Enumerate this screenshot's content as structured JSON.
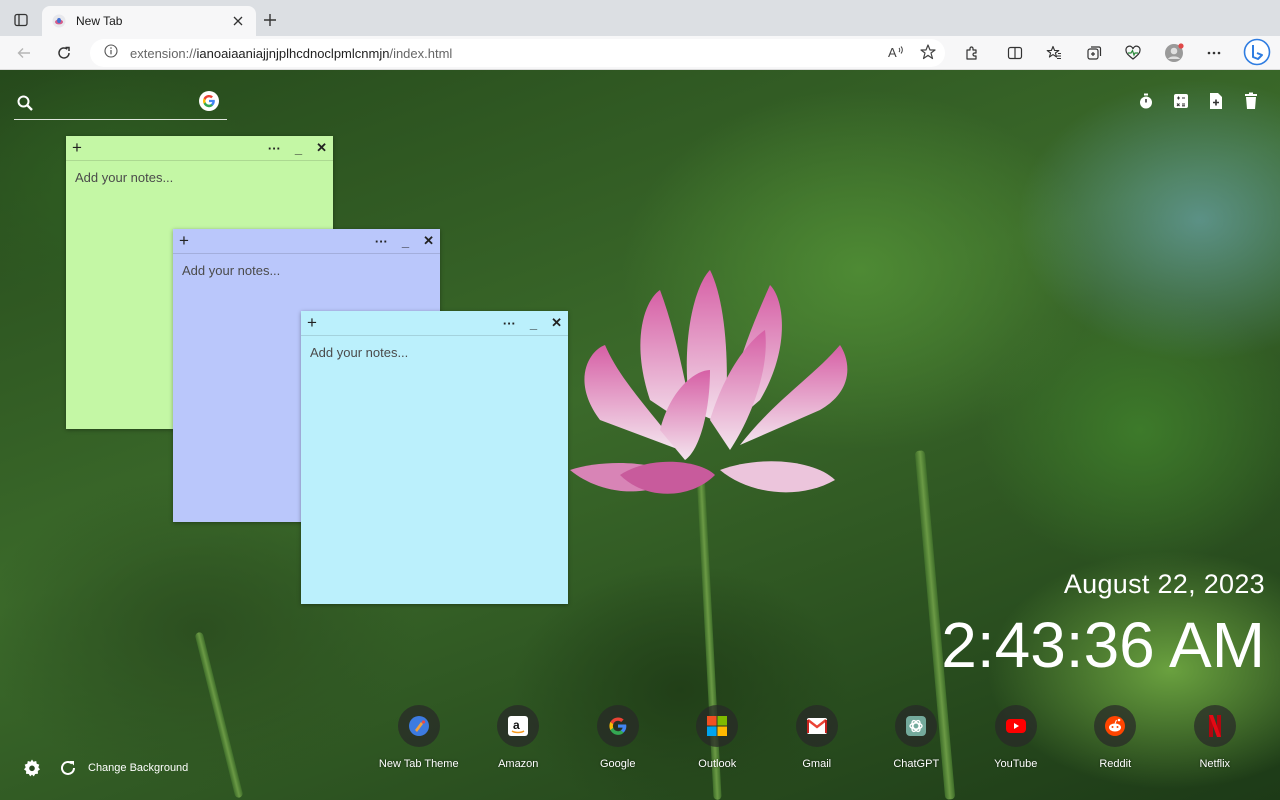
{
  "browser": {
    "tab_title": "New Tab",
    "url_prefix": "extension://",
    "url_host": "ianoaiaaniajjnjplhcdnoclpmlcnmjn",
    "url_path": "/index.html"
  },
  "icons": {
    "tab_actions": "tab-actions-icon",
    "favicon": "lotus-favicon-icon",
    "read_aloud": "read-aloud-icon",
    "favorite": "star-icon",
    "extensions": "puzzle-icon",
    "split_screen": "split-screen-icon",
    "favorites": "favorites-icon",
    "collections": "collections-icon",
    "browser_essentials": "heart-pulse-icon",
    "profile": "profile-icon",
    "settings_more": "more-icon",
    "bing": "bing-icon"
  },
  "search": {
    "placeholder": "",
    "engine": "Google"
  },
  "notes": [
    {
      "placeholder": "Add your notes...",
      "color": "#c4f7a5"
    },
    {
      "placeholder": "Add your notes...",
      "color": "#bac7fb"
    },
    {
      "placeholder": "Add your notes...",
      "color": "#bbf0fc"
    }
  ],
  "clock": {
    "date": "August 22, 2023",
    "time": "2:43:36 AM"
  },
  "shortcuts": [
    {
      "label": "New Tab Theme",
      "icon": "new-tab-theme-icon"
    },
    {
      "label": "Amazon",
      "icon": "amazon-icon"
    },
    {
      "label": "Google",
      "icon": "google-icon"
    },
    {
      "label": "Outlook",
      "icon": "outlook-icon"
    },
    {
      "label": "Gmail",
      "icon": "gmail-icon"
    },
    {
      "label": "ChatGPT",
      "icon": "chatgpt-icon"
    },
    {
      "label": "YouTube",
      "icon": "youtube-icon"
    },
    {
      "label": "Reddit",
      "icon": "reddit-icon"
    },
    {
      "label": "Netflix",
      "icon": "netflix-icon"
    }
  ],
  "footer": {
    "change_background": "Change Background"
  },
  "colors": {
    "edge_tabbar": "#dcdfe3",
    "toolbar": "#f7f7f8",
    "note_green": "#c4f7a5",
    "note_purple": "#bac7fb",
    "note_cyan": "#bbf0fc"
  }
}
